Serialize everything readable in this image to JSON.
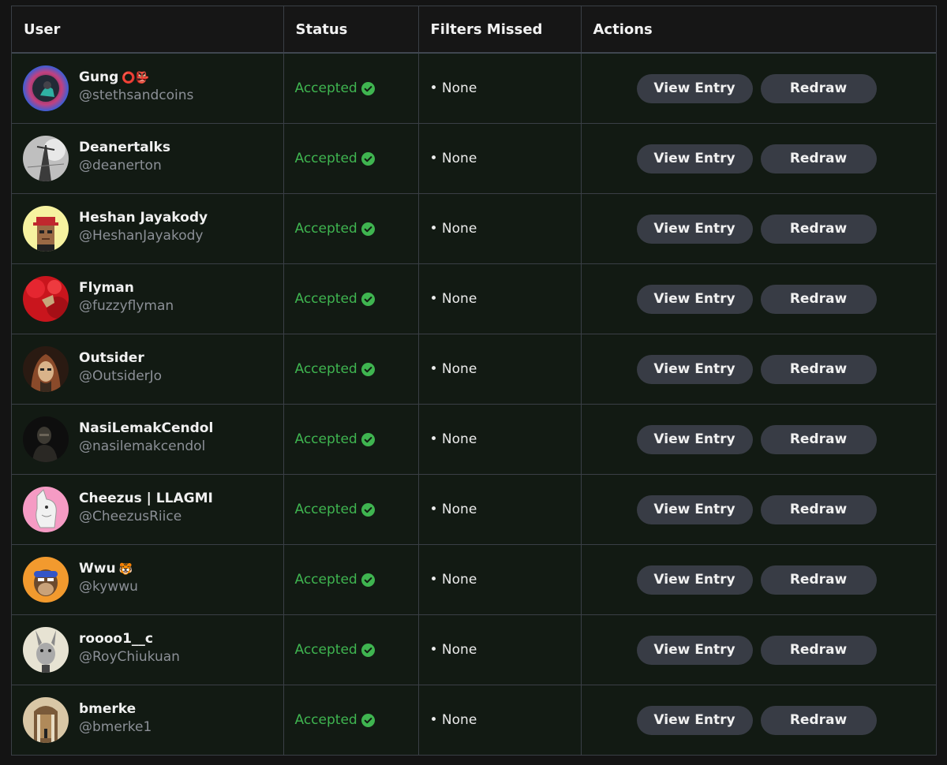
{
  "table": {
    "headers": {
      "user": "User",
      "status": "Status",
      "filters": "Filters Missed",
      "actions": "Actions"
    },
    "view_label": "View Entry",
    "redraw_label": "Redraw",
    "status_color": "#3fb550",
    "rows": [
      {
        "name": "Gung",
        "emoji": "⭕👺",
        "handle": "@stethsandcoins",
        "status": "Accepted",
        "filters": "• None"
      },
      {
        "name": "Deanertalks",
        "emoji": "",
        "handle": "@deanerton",
        "status": "Accepted",
        "filters": "• None"
      },
      {
        "name": "Heshan Jayakody",
        "emoji": "",
        "handle": "@HeshanJayakody",
        "status": "Accepted",
        "filters": "• None"
      },
      {
        "name": "Flyman",
        "emoji": "",
        "handle": "@fuzzyflyman",
        "status": "Accepted",
        "filters": "• None"
      },
      {
        "name": "Outsider",
        "emoji": "",
        "handle": "@OutsiderJo",
        "status": "Accepted",
        "filters": "• None"
      },
      {
        "name": "NasiLemakCendol",
        "emoji": "",
        "handle": "@nasilemakcendol",
        "status": "Accepted",
        "filters": "• None"
      },
      {
        "name": "Cheezus | LLAGMI",
        "emoji": "",
        "handle": "@CheezusRiice",
        "status": "Accepted",
        "filters": "• None"
      },
      {
        "name": "Wwu",
        "emoji": "🐯",
        "handle": "@kywwu",
        "status": "Accepted",
        "filters": "• None"
      },
      {
        "name": "roooo1__c",
        "emoji": "",
        "handle": "@RoyChiukuan",
        "status": "Accepted",
        "filters": "• None"
      },
      {
        "name": "bmerke",
        "emoji": "",
        "handle": "@bmerke1",
        "status": "Accepted",
        "filters": "• None"
      }
    ]
  }
}
